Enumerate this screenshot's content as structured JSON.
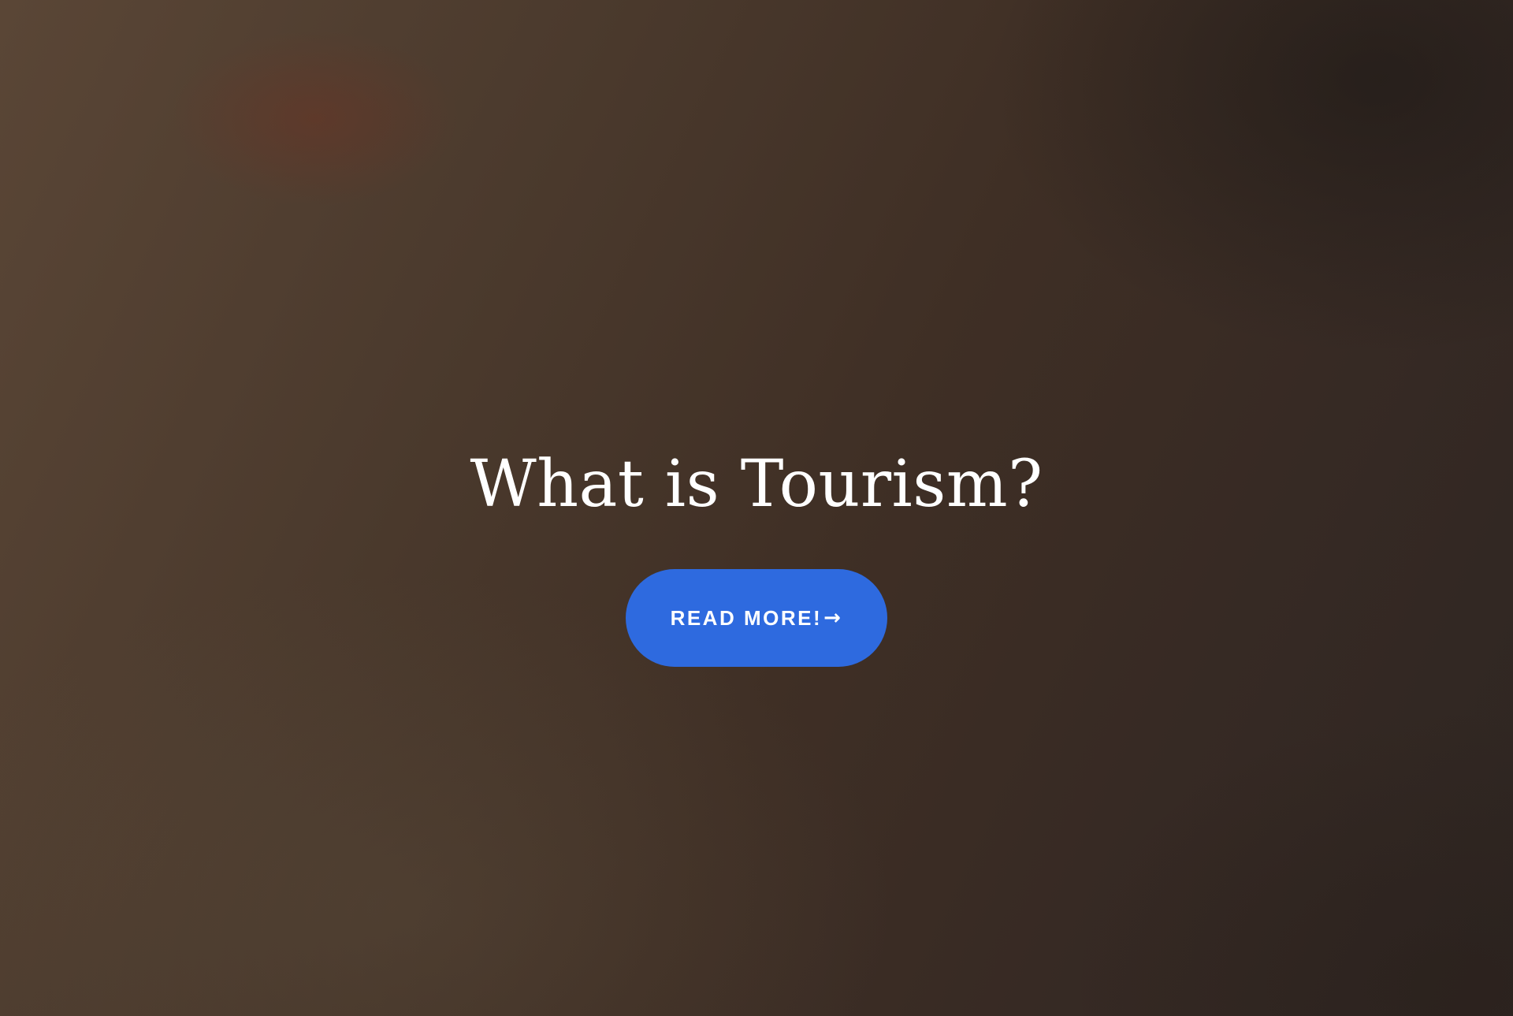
{
  "hero": {
    "title": "What is Tourism?",
    "button": {
      "label": "READ MORE!",
      "arrow": "→",
      "icon": "arrow-right-icon",
      "color": "#2e6adf"
    }
  }
}
